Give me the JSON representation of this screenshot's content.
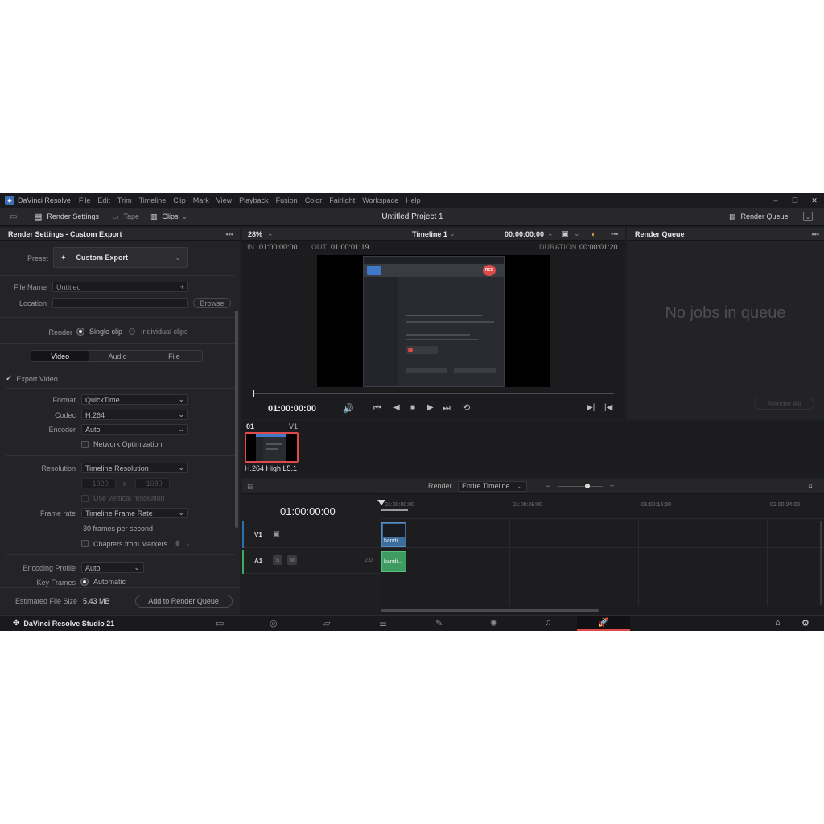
{
  "app": {
    "window_title": "DaVinci Resolve",
    "menu": [
      "File",
      "Edit",
      "Trim",
      "Timeline",
      "Clip",
      "Mark",
      "View",
      "Playback",
      "Fusion",
      "Color",
      "Fairlight",
      "Workspace",
      "Help"
    ],
    "window_controls": {
      "minimize": "–",
      "maximize": "⧠",
      "close": "✕"
    }
  },
  "toolbar": {
    "render_settings": "Render Settings",
    "tape": "Tape",
    "clips": "Clips",
    "project_title": "Untitled Project 1",
    "render_queue": "Render Queue"
  },
  "render_settings": {
    "header": "Render Settings - Custom Export",
    "more": "•••",
    "preset_label": "Preset",
    "preset_value": "Custom Export",
    "file_name_label": "File Name",
    "file_name_value": "Untitled",
    "location_label": "Location",
    "location_value": "",
    "browse": "Browse",
    "render_label": "Render",
    "single_clip": "Single clip",
    "individual_clips": "Individual clips",
    "tabs": [
      "Video",
      "Audio",
      "File"
    ],
    "export_video": "Export Video",
    "format_label": "Format",
    "format_value": "QuickTime",
    "codec_label": "Codec",
    "codec_value": "H.264",
    "encoder_label": "Encoder",
    "encoder_value": "Auto",
    "network_optimization": "Network Optimization",
    "resolution_label": "Resolution",
    "resolution_value": "Timeline Resolution",
    "res_width": "1920",
    "res_x": "x",
    "res_height": "1080",
    "use_vertical": "Use vertical resolution",
    "frame_rate_label": "Frame rate",
    "frame_rate_value": "Timeline Frame Rate",
    "fps_text": "30 frames per second",
    "chapters_from_markers": "Chapters from Markers",
    "encoding_profile_label": "Encoding Profile",
    "encoding_profile_value": "Auto",
    "key_frames_label": "Key Frames",
    "key_frames_value": "Automatic",
    "estimated_size_label": "Estimated File Size",
    "estimated_size_value": "5.43 MB",
    "add_to_queue": "Add to Render Queue"
  },
  "viewer": {
    "zoom": "28%",
    "timeline_name": "Timeline 1",
    "timecode_top": "00:00:00:00",
    "more": "•••",
    "in_label": "IN",
    "in_value": "01:00:00:00",
    "out_label": "OUT",
    "out_value": "01:00:01:19",
    "duration_label": "DURATION",
    "duration_value": "00:00:01:20",
    "current_timecode": "01:00:00:00",
    "rec_label": "REC"
  },
  "render_queue": {
    "header": "Render Queue",
    "more": "•••",
    "empty_text": "No jobs in queue",
    "render_all": "Render All"
  },
  "clip": {
    "index": "01",
    "track": "V1",
    "codec_label": "H.264 High L5.1"
  },
  "timeline": {
    "render_label": "Render",
    "render_scope": "Entire Timeline",
    "timecode": "01:00:00:00",
    "ruler": [
      "01:00:00:00",
      "01:00:08:00",
      "01:00:16:00",
      "01:00:24:00"
    ],
    "v1": "V1",
    "a1": "A1",
    "solo": "S",
    "mute": "M",
    "audio_channels": "2.0",
    "video_clip_name": "bandi...",
    "audio_clip_name": "bandi..."
  },
  "bottom": {
    "brand": "DaVinci Resolve Studio 21",
    "pages": [
      "media-page-icon",
      "cut-page-icon",
      "edit-page-icon",
      "fusion-page-icon",
      "color-page-icon",
      "fairlight-page-icon",
      "deliver-page-icon"
    ]
  },
  "colors": {
    "accent_red": "#e04949",
    "clip_blue": "#3c6e9c",
    "clip_green": "#3e9b62",
    "video_track_marker": "#2e6fb0",
    "audio_track_marker": "#3fa863"
  }
}
